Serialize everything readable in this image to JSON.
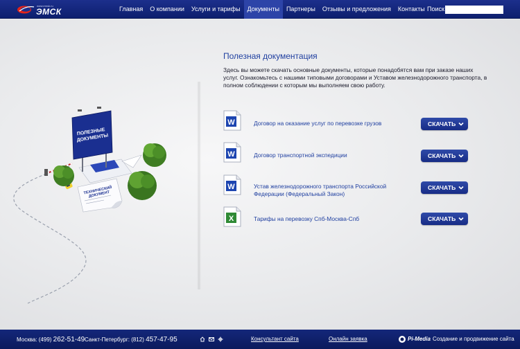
{
  "header": {
    "logo_small": "www.emsk.ru",
    "logo_text": "ЭМСК",
    "nav": [
      "Главная",
      "О компании",
      "Услуги и тарифы",
      "Документы",
      "Партнеры",
      "Отзывы и предложения",
      "Контакты"
    ],
    "active_nav": "Документы",
    "search_label": "Поиск",
    "search_value": ""
  },
  "illustration": {
    "billboard_text": "ПОЛЕЗНЫЕ ДОКУМЕНТЫ",
    "paper_text": "ТЕХНИЧЕСКИЙ ДОКУМЕНТ"
  },
  "main": {
    "title": "Полезная документация",
    "intro": "Здесь вы можете скачать основные документы, которые понадобятся вам при заказе наших услуг. Ознакомьтесь с нашими типовыми договорами и Уставом железнодорожного транспорта, в полном соблюдении с которым мы выполняем свою работу.",
    "documents": [
      {
        "name": "Договор на оказание услуг по перевозке грузов",
        "type": "word",
        "button": "СКАЧАТЬ"
      },
      {
        "name": "Договор транспортной экспедиции",
        "type": "word",
        "button": "СКАЧАТЬ"
      },
      {
        "name": "Устав железнодорожного транспорта Российской Федерации (Федеральный Закон)",
        "type": "word",
        "button": "СКАЧАТЬ"
      },
      {
        "name": " Тарифы на перевозку Спб-Москва-Спб",
        "type": "excel",
        "button": "СКАЧАТЬ"
      }
    ]
  },
  "footer": {
    "moscow_label": "Москва: (499) ",
    "moscow_num": "262-51-49",
    "spb_label": "Санкт-Петербург: (812) ",
    "spb_num": "457-47-95",
    "consultant": "Консультант сайта",
    "order": "Онлайн заявка",
    "dev_logo": "Pi-Media",
    "dev_text": "Создание и продвижение сайта"
  },
  "colors": {
    "header_bg": "#1c2f8c",
    "accent": "#1f3fa0",
    "button": "#1f3596",
    "logo_red": "#e2231a"
  }
}
